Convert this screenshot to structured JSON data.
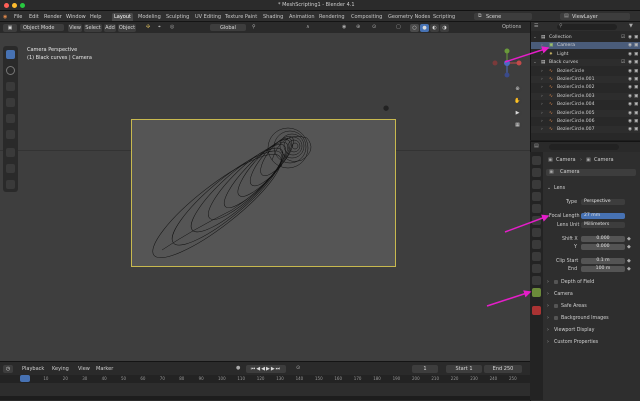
{
  "window": {
    "title": "* MeshScripting1 - Blender 4.1"
  },
  "menu": [
    "File",
    "Edit",
    "Render",
    "Window",
    "Help"
  ],
  "workspaces": [
    "Layout",
    "Modeling",
    "Sculpting",
    "UV Editing",
    "Texture Paint",
    "Shading",
    "Animation",
    "Rendering",
    "Compositing",
    "Geometry Nodes",
    "Scripting"
  ],
  "scene": {
    "name": "Scene",
    "view_layer": "ViewLayer"
  },
  "viewport": {
    "mode": "Object Mode",
    "menu": [
      "View",
      "Select",
      "Add",
      "Object"
    ],
    "transform": "Global",
    "options": "Options",
    "overlay_title": "Camera Perspective",
    "overlay_subtitle": "(1) Black curves | Camera"
  },
  "outliner": {
    "items": [
      {
        "label": "Collection",
        "indent": 0,
        "kind": "collection"
      },
      {
        "label": "Camera",
        "indent": 1,
        "kind": "camera",
        "selected": true
      },
      {
        "label": "Light",
        "indent": 1,
        "kind": "light"
      },
      {
        "label": "Black curves",
        "indent": 0,
        "kind": "collection"
      },
      {
        "label": "BezierCircle",
        "indent": 1,
        "kind": "curve"
      },
      {
        "label": "BezierCircle.001",
        "indent": 1,
        "kind": "curve"
      },
      {
        "label": "BezierCircle.002",
        "indent": 1,
        "kind": "curve"
      },
      {
        "label": "BezierCircle.003",
        "indent": 1,
        "kind": "curve"
      },
      {
        "label": "BezierCircle.004",
        "indent": 1,
        "kind": "curve"
      },
      {
        "label": "BezierCircle.005",
        "indent": 1,
        "kind": "curve"
      },
      {
        "label": "BezierCircle.006",
        "indent": 1,
        "kind": "curve"
      },
      {
        "label": "BezierCircle.007",
        "indent": 1,
        "kind": "curve"
      }
    ]
  },
  "properties": {
    "breadcrumb_object": "Camera",
    "breadcrumb_data": "Camera",
    "data_name": "Camera",
    "lens_section": "Lens",
    "type_label": "Type",
    "type_value": "Perspective",
    "focal_label": "Focal Length",
    "focal_value": "27 mm",
    "lens_unit_label": "Lens Unit",
    "lens_unit_value": "Millimeters",
    "shift_x_label": "Shift X",
    "shift_x_value": "0.000",
    "shift_y_label": "Y",
    "shift_y_value": "0.000",
    "clip_start_label": "Clip Start",
    "clip_start_value": "0.1 m",
    "clip_end_label": "End",
    "clip_end_value": "100 m",
    "sections": [
      "Depth of Field",
      "Camera",
      "Safe Areas",
      "Background Images",
      "Viewport Display",
      "Custom Properties"
    ]
  },
  "timeline": {
    "menu": [
      "Playback",
      "Keying",
      "View",
      "Marker"
    ],
    "current_frame": "1",
    "start_label": "Start",
    "start_value": "1",
    "end_label": "End",
    "end_value": "250",
    "ticks": [
      "0",
      "10",
      "20",
      "30",
      "40",
      "50",
      "60",
      "70",
      "80",
      "90",
      "100",
      "110",
      "120",
      "130",
      "140",
      "150",
      "160",
      "170",
      "180",
      "190",
      "200",
      "210",
      "220",
      "230",
      "240",
      "250"
    ]
  },
  "statusbar": {
    "version": "4.1.0"
  },
  "colors": {
    "accent": "#4772b3",
    "selection": "#5680c2",
    "annotation_arrow": "#e51ec9",
    "camera_frame": "#c8b94f"
  }
}
